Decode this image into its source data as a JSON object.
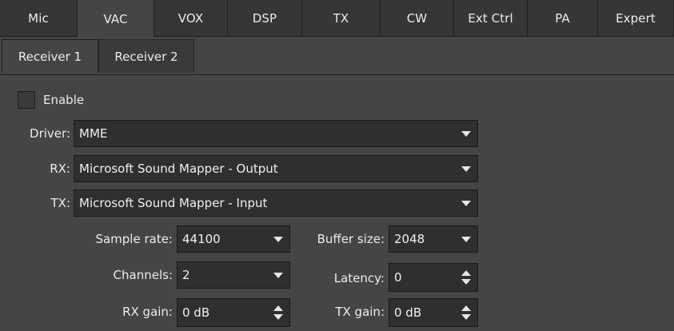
{
  "tabs": [
    {
      "label": "Mic",
      "active": false
    },
    {
      "label": "VAC",
      "active": true
    },
    {
      "label": "VOX",
      "active": false
    },
    {
      "label": "DSP",
      "active": false
    },
    {
      "label": "TX",
      "active": false
    },
    {
      "label": "CW",
      "active": false
    },
    {
      "label": "Ext Ctrl",
      "active": false
    },
    {
      "label": "PA",
      "active": false
    },
    {
      "label": "Expert",
      "active": false
    }
  ],
  "subtabs": [
    {
      "label": "Receiver 1",
      "active": true
    },
    {
      "label": "Receiver 2",
      "active": false
    }
  ],
  "enable": {
    "label": "Enable",
    "checked": false
  },
  "driver": {
    "label": "Driver:",
    "value": "MME"
  },
  "rx": {
    "label": "RX:",
    "value": "Microsoft Sound Mapper - Output"
  },
  "tx": {
    "label": "TX:",
    "value": "Microsoft Sound Mapper - Input"
  },
  "sample_rate": {
    "label": "Sample rate:",
    "value": "44100"
  },
  "buffer_size": {
    "label": "Buffer size:",
    "value": "2048"
  },
  "channels": {
    "label": "Channels:",
    "value": "2"
  },
  "latency": {
    "label": "Latency:",
    "value": "0"
  },
  "rx_gain": {
    "label": "RX gain:",
    "value": "0 dB"
  },
  "tx_gain": {
    "label": "TX gain:",
    "value": "0 dB"
  }
}
